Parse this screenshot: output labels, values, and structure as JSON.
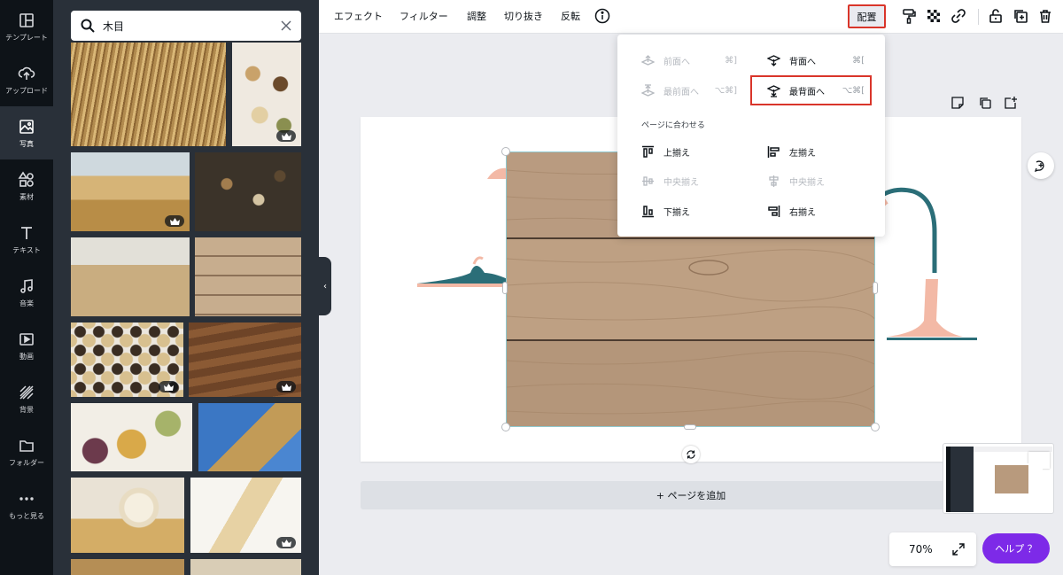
{
  "sidebar": {
    "items": [
      {
        "label": "テンプレート",
        "icon": "template-icon"
      },
      {
        "label": "アップロード",
        "icon": "upload-icon"
      },
      {
        "label": "写真",
        "icon": "photo-icon"
      },
      {
        "label": "素材",
        "icon": "elements-icon"
      },
      {
        "label": "テキスト",
        "icon": "text-icon"
      },
      {
        "label": "音楽",
        "icon": "music-icon"
      },
      {
        "label": "動画",
        "icon": "video-icon"
      },
      {
        "label": "背景",
        "icon": "background-icon"
      },
      {
        "label": "フォルダー",
        "icon": "folder-icon"
      },
      {
        "label": "もっと見る",
        "icon": "more-icon"
      }
    ]
  },
  "search": {
    "value": "木目"
  },
  "toolbar": {
    "effects": "エフェクト",
    "filter": "フィルター",
    "adjust": "調整",
    "crop": "切り抜き",
    "flip": "反転",
    "arrange": "配置"
  },
  "arrange_menu": {
    "forward": {
      "label": "前面へ",
      "shortcut": "⌘]"
    },
    "backward": {
      "label": "背面へ",
      "shortcut": "⌘["
    },
    "to_front": {
      "label": "最前面へ",
      "shortcut": "⌥⌘]"
    },
    "to_back": {
      "label": "最背面へ",
      "shortcut": "⌥⌘["
    },
    "align_section": "ページに合わせる",
    "align_top": "上揃え",
    "align_left": "左揃え",
    "align_middle": "中央揃え",
    "align_center": "中央揃え",
    "align_bottom": "下揃え",
    "align_right": "右揃え"
  },
  "canvas": {
    "add_page": "+ ページを追加"
  },
  "footer": {
    "zoom": "70%",
    "help": "ヘルプ ？"
  },
  "colors": {
    "accent": "#7d2ae8",
    "highlight": "#d9352a",
    "rail": "#0e1318",
    "panel": "#293039"
  }
}
